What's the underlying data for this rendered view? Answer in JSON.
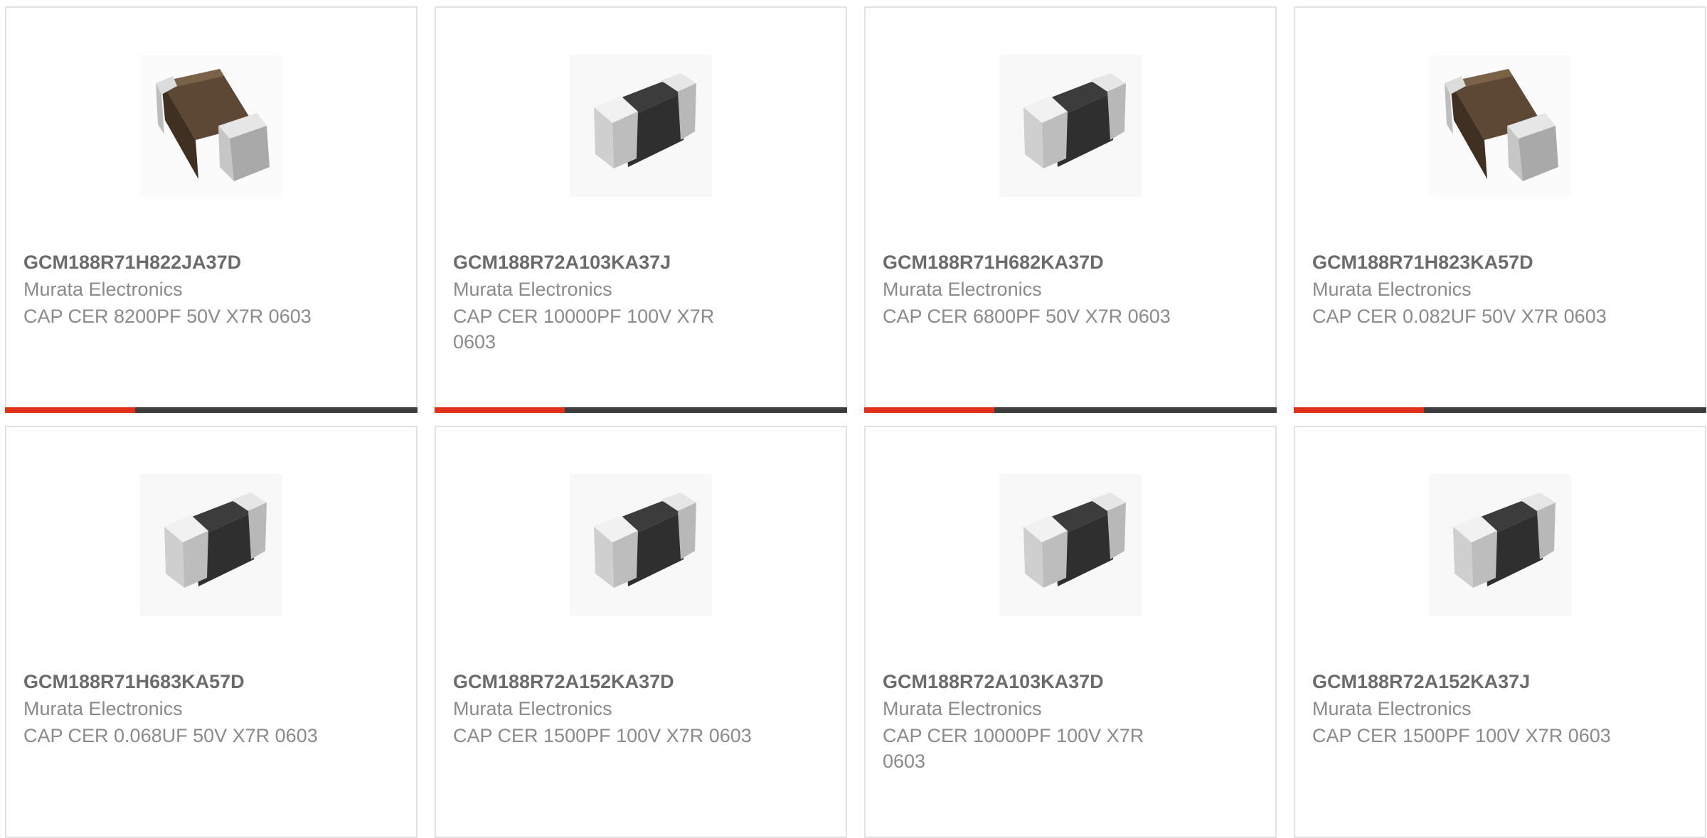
{
  "products": [
    {
      "part_number": "GCM188R71H822JA37D",
      "manufacturer": "Murata Electronics",
      "description": "CAP CER 8200PF 50V X7R 0603",
      "image": "brown-chip-image"
    },
    {
      "part_number": "GCM188R72A103KA37J",
      "manufacturer": "Murata Electronics",
      "description": "CAP CER 10000PF 100V X7R 0603",
      "image": "gray-chip-image"
    },
    {
      "part_number": "GCM188R71H682KA37D",
      "manufacturer": "Murata Electronics",
      "description": "CAP CER 6800PF 50V X7R 0603",
      "image": "gray-chip-image"
    },
    {
      "part_number": "GCM188R71H823KA57D",
      "manufacturer": "Murata Electronics",
      "description": "CAP CER 0.082UF 50V X7R 0603",
      "image": "brown-chip-image"
    },
    {
      "part_number": "GCM188R71H683KA57D",
      "manufacturer": "Murata Electronics",
      "description": "CAP CER 0.068UF 50V X7R 0603",
      "image": "gray-chip-image"
    },
    {
      "part_number": "GCM188R72A152KA37D",
      "manufacturer": "Murata Electronics",
      "description": "CAP CER 1500PF 100V X7R 0603",
      "image": "gray-chip-image"
    },
    {
      "part_number": "GCM188R72A103KA37D",
      "manufacturer": "Murata Electronics",
      "description": "CAP CER 10000PF 100V X7R 0603",
      "image": "gray-chip-image"
    },
    {
      "part_number": "GCM188R72A152KA37J",
      "manufacturer": "Murata Electronics",
      "description": "CAP CER 1500PF 100V X7R 0603",
      "image": "gray-chip-image"
    }
  ],
  "colors": {
    "accent": "#e0321a",
    "bar": "#3d3d3d",
    "card_border": "#e2e2e2",
    "part_number_text": "#6b6b6b",
    "secondary_text": "#8a8a8a"
  }
}
